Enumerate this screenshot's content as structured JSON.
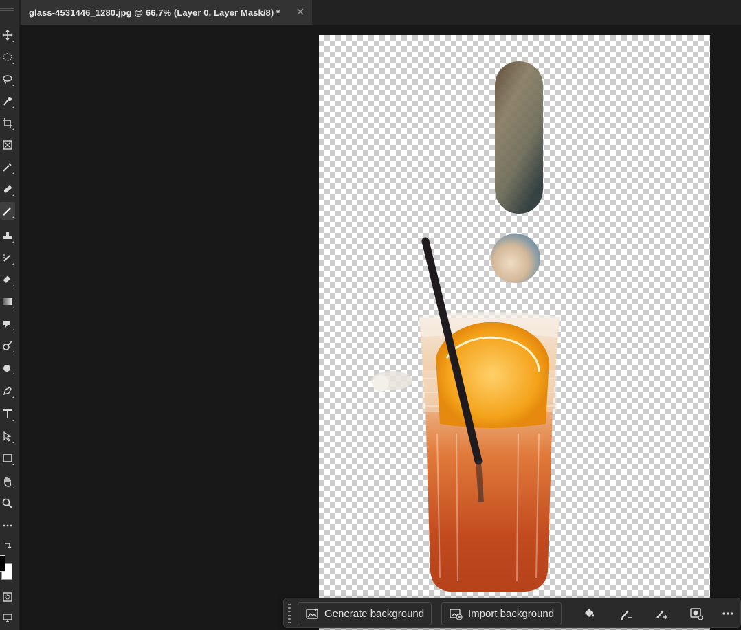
{
  "document": {
    "tab_title": "glass-4531446_1280.jpg @ 66,7% (Layer 0, Layer Mask/8) *",
    "close_icon": "close-icon"
  },
  "toolbar": {
    "tools": [
      "move",
      "marquee",
      "lasso",
      "quick-selection",
      "crop",
      "frame",
      "eyedropper",
      "spot-healing",
      "brush",
      "clone-stamp",
      "history-brush",
      "eraser",
      "gradient",
      "smudge",
      "dodge",
      "blur",
      "pen",
      "type",
      "path-selection",
      "rectangle",
      "hand",
      "zoom",
      "more"
    ],
    "active_tool": "brush",
    "foreground_color": "#000000",
    "background_color": "#ffffff"
  },
  "taskbar": {
    "generate_background_label": "Generate background",
    "import_background_label": "Import background",
    "icons": [
      "paint-bucket-icon",
      "brush-subtract-icon",
      "brush-add-icon",
      "mask-options-icon",
      "more-icon"
    ]
  },
  "colors": {
    "panel": "#2b2b2b",
    "workspace": "#181818",
    "tab_active": "#333333",
    "checker_dark": "#cccccc",
    "checker_light": "#ffffff"
  }
}
